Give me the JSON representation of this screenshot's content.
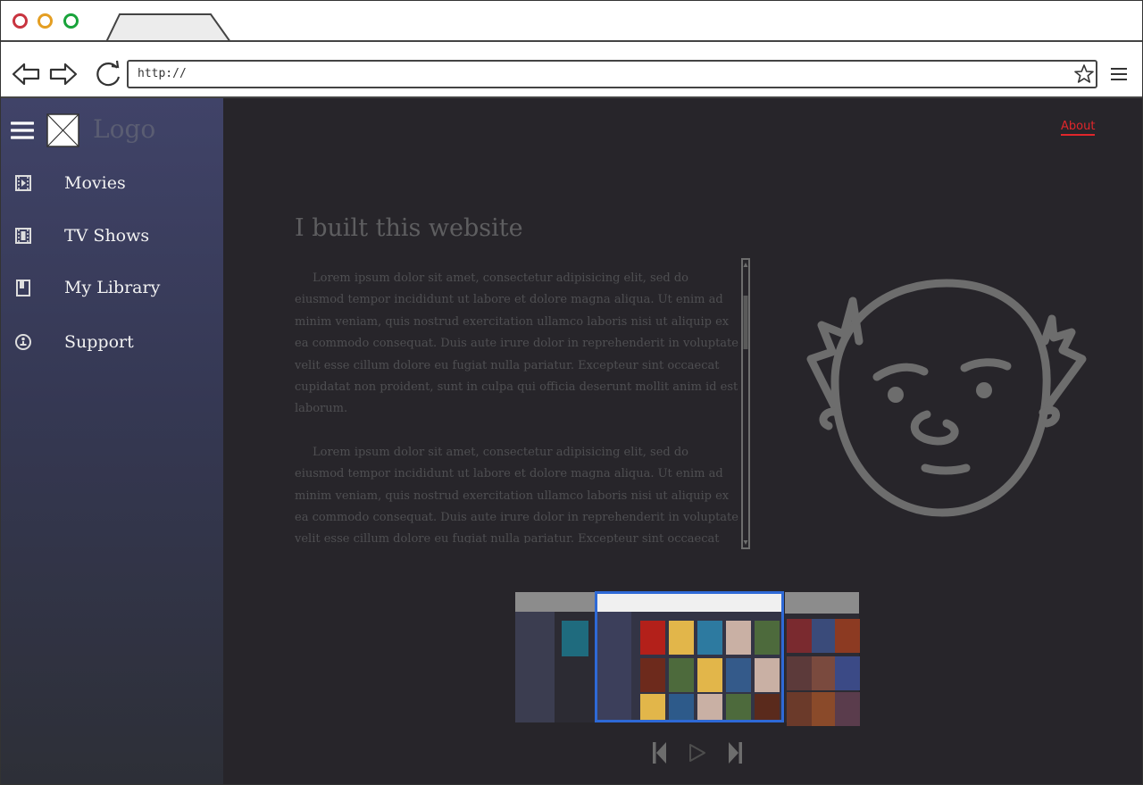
{
  "browser": {
    "url": "http://",
    "traffic_lights": [
      "#c8343f",
      "#e49e22",
      "#18a33a"
    ]
  },
  "sidebar": {
    "logo_text": "Logo",
    "items": [
      {
        "label": "Movies",
        "icon": "film-play-icon"
      },
      {
        "label": "TV Shows",
        "icon": "film-strip-icon"
      },
      {
        "label": "My Library",
        "icon": "book-icon"
      },
      {
        "label": "Support",
        "icon": "lifebuoy-icon"
      }
    ]
  },
  "main": {
    "nav_link": "About",
    "heading": "I built this website",
    "paragraphs": [
      "Lorem ipsum dolor sit amet, consectetur adipisicing elit, sed do eiusmod tempor incididunt ut labore et dolore magna aliqua. Ut enim ad minim veniam, quis nostrud exercitation ullamco laboris nisi ut aliquip ex ea commodo consequat. Duis aute irure dolor in reprehenderit in voluptate velit esse cillum dolore eu fugiat nulla pariatur. Excepteur sint occaecat cupidatat non proident, sunt in culpa qui officia deserunt mollit anim id est laborum.",
      "Lorem ipsum dolor sit amet, consectetur adipisicing elit, sed do eiusmod tempor incididunt ut labore et dolore magna aliqua. Ut enim ad minim veniam, quis nostrud exercitation ullamco laboris nisi ut aliquip ex ea commodo consequat. Duis aute irure dolor in reprehenderit in voluptate velit esse cillum dolore eu fugiat nulla pariatur. Excepteur sint occaecat cupidatat non proident, sunt in culpa qui officia deserunt mollit anim id est laborum."
    ]
  },
  "colors": {
    "sidebar_top": "#404368",
    "main_bg": "#27252a",
    "accent_link": "#e0262b",
    "carousel_active_border": "#2e69d6"
  }
}
